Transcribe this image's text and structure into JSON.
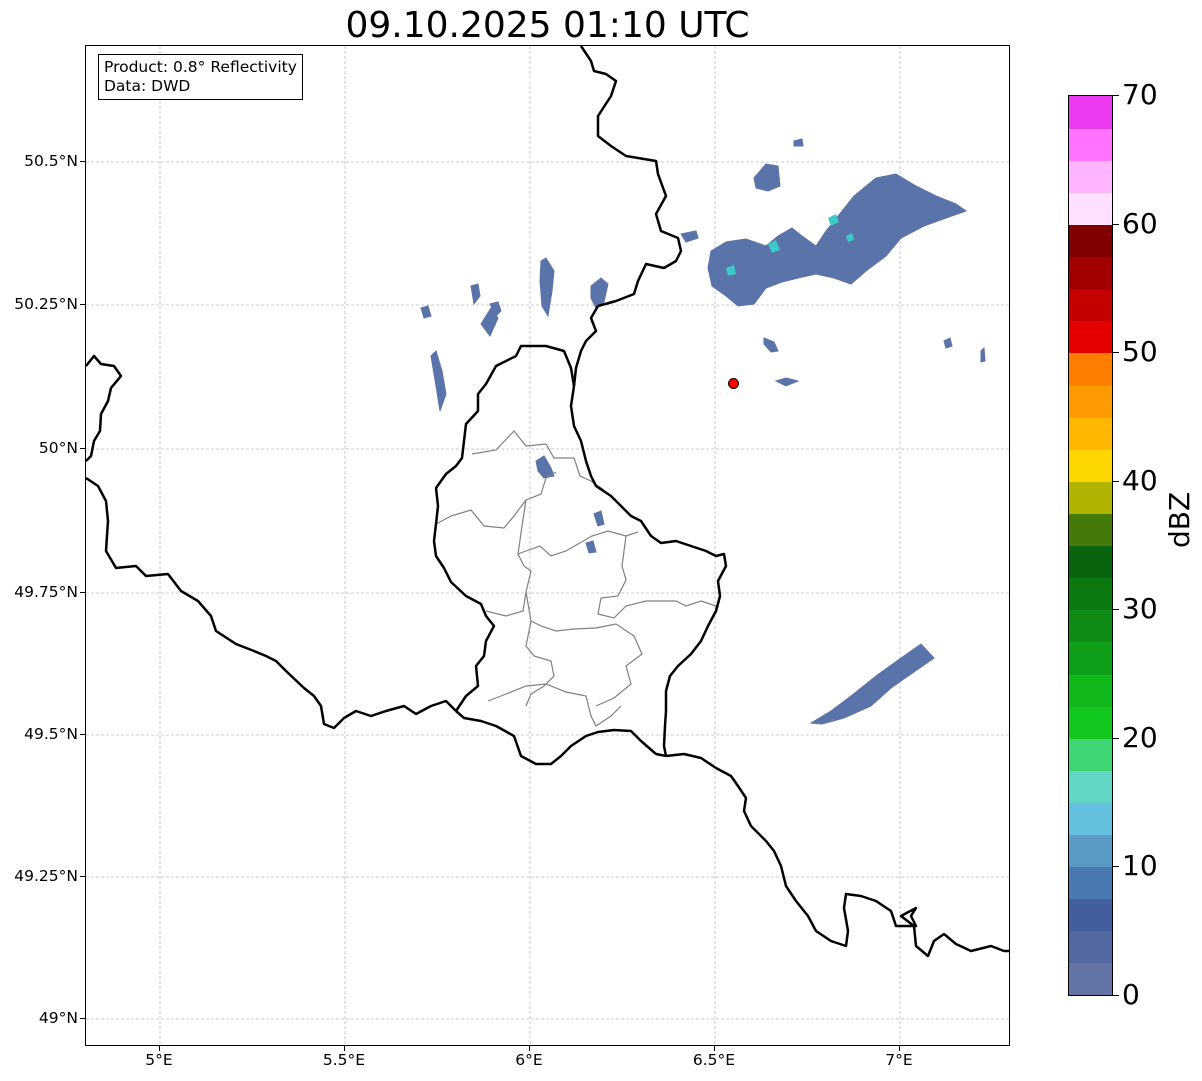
{
  "title": "09.10.2025 01:10 UTC",
  "info": {
    "product": "Product: 0.8° Reflectivity",
    "data_source": "Data: DWD"
  },
  "axes": {
    "lon_ticks": [
      "5°E",
      "5.5°E",
      "6°E",
      "6.5°E",
      "7°E"
    ],
    "lat_ticks": [
      "50.5°N",
      "50.25°N",
      "50°N",
      "49.75°N",
      "49.5°N",
      "49.25°N",
      "49°N"
    ],
    "lon_range": [
      4.8,
      7.3
    ],
    "lat_range": [
      48.95,
      50.7
    ]
  },
  "radar_site": {
    "lon": 6.55,
    "lat": 50.11,
    "color": "#ff0000"
  },
  "colorbar": {
    "unit": "dBZ",
    "min": 0,
    "max": 70,
    "step": 2.5,
    "tick_labels": [
      "0",
      "10",
      "20",
      "30",
      "40",
      "50",
      "60",
      "70"
    ],
    "tick_values": [
      0,
      10,
      20,
      30,
      40,
      50,
      60,
      70
    ],
    "colors": [
      "#6473a6",
      "#5468a0",
      "#435e9f",
      "#4a78b0",
      "#5a9bc6",
      "#64c0dc",
      "#61d7c4",
      "#3ed572",
      "#12c71d",
      "#11b81c",
      "#109f18",
      "#0f8c15",
      "#0c7812",
      "#08640e",
      "#437a0a",
      "#b0b300",
      "#ffd700",
      "#ffb700",
      "#ff9b00",
      "#ff7e00",
      "#e50000",
      "#c40000",
      "#a20000",
      "#800000",
      "#ffe0ff",
      "#ffb4ff",
      "#ff73ff",
      "#eb3aef"
    ]
  },
  "colors": {
    "echo_main": "#5a73a8",
    "echo_high": "#3ec8c8",
    "country_border": "#000000",
    "admin_border": "#808080",
    "grid": "#bbbbbb"
  }
}
